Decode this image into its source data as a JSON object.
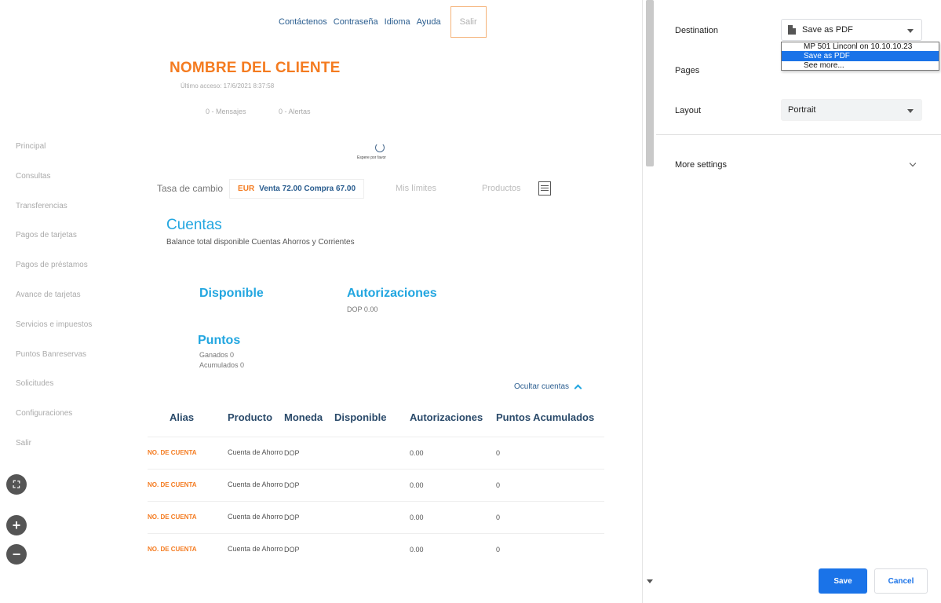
{
  "preview": {
    "topnav": {
      "contact": "Contáctenos",
      "password": "Contraseña",
      "language": "Idioma",
      "help": "Ayuda",
      "logout": "Salir"
    },
    "client_name": "NOMBRE DEL CLIENTE",
    "last_access": "Último acceso: 17/6/2021 8:37:58",
    "messages": "0 - Mensajes",
    "alerts": "0 - Alertas",
    "sidebar": [
      "Principal",
      "Consultas",
      "Transferencias",
      "Pagos de tarjetas",
      "Pagos de préstamos",
      "Avance de tarjetas",
      "Servicios e impuestos",
      "Puntos Banreservas",
      "Solicitudes",
      "Configuraciones",
      "Salir"
    ],
    "loading_text": "Espere por favor",
    "rates": {
      "label": "Tasa de cambio",
      "currency": "EUR",
      "values": "Venta 72.00 Compra 67.00",
      "limits": "Mis límites",
      "products": "Productos"
    },
    "accounts_title": "Cuentas",
    "accounts_subtitle": "Balance total disponible Cuentas Ahorros y Corrientes",
    "available_heading": "Disponible",
    "authorizations_heading": "Autorizaciones",
    "authorizations_value": "DOP 0.00",
    "points_heading": "Puntos",
    "points_earned": "Ganados 0",
    "points_accumulated": "Acumulados 0",
    "hide_accounts": "Ocultar cuentas",
    "table": {
      "headers": [
        "Alias",
        "Producto",
        "Moneda",
        "Disponible",
        "Autorizaciones",
        "Puntos Acumulados"
      ],
      "rows": [
        [
          "NO. DE CUENTA",
          "Cuenta de Ahorro",
          "DOP",
          "",
          "0.00",
          "0"
        ],
        [
          "NO. DE CUENTA",
          "Cuenta de Ahorro",
          "DOP",
          "",
          "0.00",
          "0"
        ],
        [
          "NO. DE CUENTA",
          "Cuenta de Ahorro",
          "DOP",
          "",
          "0.00",
          "0"
        ],
        [
          "NO. DE CUENTA",
          "Cuenta de Ahorro",
          "DOP",
          "",
          "0.00",
          "0"
        ]
      ]
    },
    "zoom": {
      "fit": "⛶",
      "in": "+",
      "out": "−"
    }
  },
  "dialog": {
    "destination_label": "Destination",
    "destination_value": "Save as PDF",
    "destination_options": [
      "MP 501 Linconl on 10.10.10.23",
      "Save as PDF",
      "See more..."
    ],
    "destination_selected_index": 1,
    "pages_label": "Pages",
    "layout_label": "Layout",
    "layout_value": "Portrait",
    "more_settings": "More settings",
    "save_button": "Save",
    "cancel_button": "Cancel"
  },
  "colors": {
    "brand_orange": "#f47b20",
    "brand_blue": "#22a6e0",
    "dialog_accent": "#1a73e8"
  }
}
